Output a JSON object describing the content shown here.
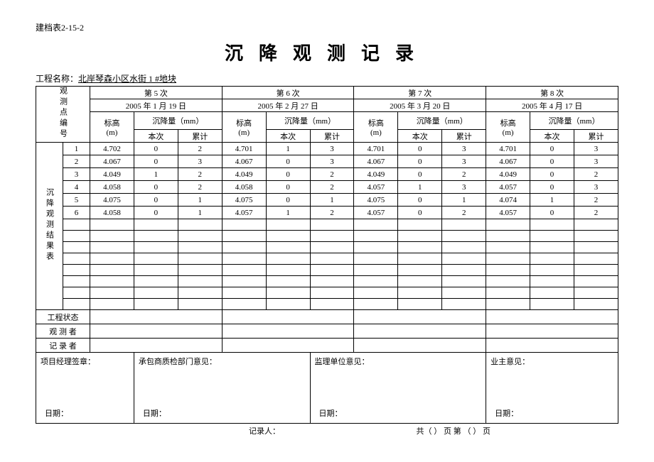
{
  "doc_id": "建档表2-15-2",
  "title": "沉降观测记录",
  "project_label": "工程名称：",
  "project_name": "北岸琴森小区水街  1  #地块",
  "side_header": "观测点编号",
  "side_label": "沉降观测结果表",
  "sessions": [
    {
      "num_label": "第  5  次",
      "date": "2005 年 1 月 19 日"
    },
    {
      "num_label": "第  6  次",
      "date": "2005 年 2 月 27 日"
    },
    {
      "num_label": "第  7  次",
      "date": "2005 年 3 月 20 日"
    },
    {
      "num_label": "第  8  次",
      "date": "2005 年 4 月 17 日"
    }
  ],
  "col_labels": {
    "elev": "标高",
    "elev_unit": "(m)",
    "settlement": "沉降量（mm）",
    "this_time": "本次",
    "cumulative": "累计"
  },
  "rows": [
    {
      "pt": "1",
      "s": [
        [
          "4.702",
          "0",
          "2"
        ],
        [
          "4.701",
          "1",
          "3"
        ],
        [
          "4.701",
          "0",
          "3"
        ],
        [
          "4.701",
          "0",
          "3"
        ]
      ]
    },
    {
      "pt": "2",
      "s": [
        [
          "4.067",
          "0",
          "3"
        ],
        [
          "4.067",
          "0",
          "3"
        ],
        [
          "4.067",
          "0",
          "3"
        ],
        [
          "4.067",
          "0",
          "3"
        ]
      ]
    },
    {
      "pt": "3",
      "s": [
        [
          "4.049",
          "1",
          "2"
        ],
        [
          "4.049",
          "0",
          "2"
        ],
        [
          "4.049",
          "0",
          "2"
        ],
        [
          "4.049",
          "0",
          "2"
        ]
      ]
    },
    {
      "pt": "4",
      "s": [
        [
          "4.058",
          "0",
          "2"
        ],
        [
          "4.058",
          "0",
          "2"
        ],
        [
          "4.057",
          "1",
          "3"
        ],
        [
          "4.057",
          "0",
          "3"
        ]
      ]
    },
    {
      "pt": "5",
      "s": [
        [
          "4.075",
          "0",
          "1"
        ],
        [
          "4.075",
          "0",
          "1"
        ],
        [
          "4.075",
          "0",
          "1"
        ],
        [
          "4.074",
          "1",
          "2"
        ]
      ]
    },
    {
      "pt": "6",
      "s": [
        [
          "4.058",
          "0",
          "1"
        ],
        [
          "4.057",
          "1",
          "2"
        ],
        [
          "4.057",
          "0",
          "2"
        ],
        [
          "4.057",
          "0",
          "2"
        ]
      ]
    }
  ],
  "empty_row_count": 8,
  "status_rows": {
    "project_status": "工程状态",
    "observer": "观 测 者",
    "recorder": "记 录 者"
  },
  "signatures": {
    "pm": "项目经理签章：",
    "contractor": "承包商质检部门意见：",
    "supervisor": "监理单位意见：",
    "owner": "业主意见：",
    "date": "日期："
  },
  "footer": {
    "recorder": "记录人：",
    "page": "共（    ） 页  第 （    ） 页"
  }
}
